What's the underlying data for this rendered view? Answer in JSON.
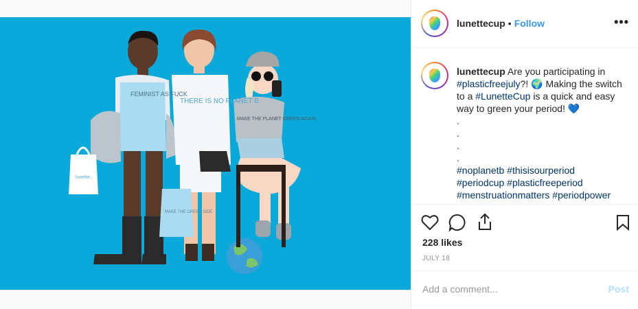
{
  "post": {
    "username": "lunettecup",
    "separator": "•",
    "follow_label": "Follow",
    "more_label": "•••"
  },
  "caption": {
    "username": "lunettecup",
    "text_1": " Are you participating in ",
    "tag_1": "#plasticfreejuly",
    "text_2": "?! 🌍 Making the switch to a ",
    "tag_2": "#LunetteCup",
    "text_3": " is a quick and easy way to green your period! 💙",
    "dots": [
      ".",
      ".",
      ".",
      "."
    ],
    "tags_line_1": "#noplanetb #thisisourperiod",
    "tags_line_2": "#periodcup #plasticfreeperiod",
    "tags_line_3": "#menstruationmatters #periodpower"
  },
  "illustration": {
    "shirt_1": "FEMINIST AS FUCK",
    "shirt_2": "THERE IS NO PLANET B",
    "shirt_3": "MAKE THE PLANET GREEN AGAIN",
    "bag_1": "lunette.",
    "bag_2": "MAKE THE GREEN SIDE",
    "accent_background": "#0aa9da"
  },
  "stats": {
    "likes": "228 likes",
    "date": "JULY 18"
  },
  "comment": {
    "placeholder": "Add a comment...",
    "post_label": "Post"
  },
  "icons": [
    "heart-icon",
    "comment-icon",
    "share-icon",
    "bookmark-icon"
  ]
}
